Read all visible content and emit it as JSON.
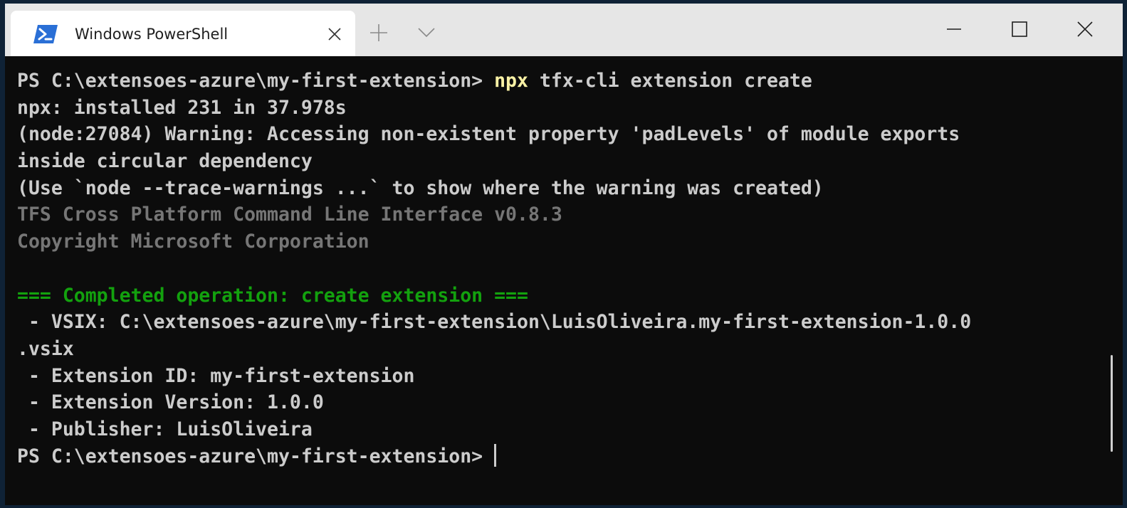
{
  "window": {
    "tab_title": "Windows PowerShell",
    "icons": {
      "tab_icon": "powershell-icon",
      "tab_close": "close-icon",
      "new_tab": "plus-icon",
      "dropdown": "chevron-down-icon",
      "minimize": "minimize-icon",
      "maximize": "maximize-icon",
      "close": "close-icon"
    }
  },
  "colors": {
    "background": "#0c0c0c",
    "foreground": "#cccccc",
    "command_highlight": "#f9f1a5",
    "gray": "#767676",
    "success": "#13a10e",
    "titlebar": "#e6e6e6",
    "powershell_blue": "#2a6fd6"
  },
  "terminal": {
    "line1": {
      "prompt": "PS C:\\extensoes-azure\\my-first-extension> ",
      "command": "npx",
      "args": " tfx-cli extension create"
    },
    "line2": "npx: installed 231 in 37.978s",
    "line3": "(node:27084) Warning: Accessing non-existent property 'padLevels' of module exports",
    "line4": "inside circular dependency",
    "line5": "(Use `node --trace-warnings ...` to show where the warning was created)",
    "line6": "TFS Cross Platform Command Line Interface v0.8.3",
    "line7": "Copyright Microsoft Corporation",
    "line9": "=== Completed operation: create extension ===",
    "line10": " - VSIX: C:\\extensoes-azure\\my-first-extension\\LuisOliveira.my-first-extension-1.0.0",
    "line11": ".vsix",
    "line12": " - Extension ID: my-first-extension",
    "line13": " - Extension Version: 1.0.0",
    "line14": " - Publisher: LuisOliveira",
    "line15": "PS C:\\extensoes-azure\\my-first-extension> "
  }
}
